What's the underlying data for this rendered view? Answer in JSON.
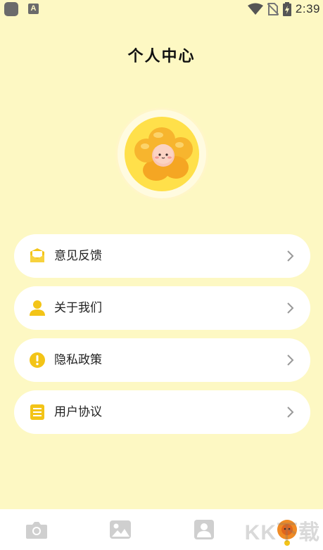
{
  "status_bar": {
    "time": "2:39",
    "icons": [
      "app-icon",
      "a-icon",
      "wifi-icon",
      "no-sim-icon",
      "battery-charging-icon"
    ]
  },
  "header": {
    "title": "个人中心"
  },
  "avatar": {
    "icon": "flower-avatar"
  },
  "menu": {
    "items": [
      {
        "label": "意见反馈",
        "icon": "feedback-envelope-icon"
      },
      {
        "label": "关于我们",
        "icon": "person-icon"
      },
      {
        "label": "隐私政策",
        "icon": "alert-circle-icon"
      },
      {
        "label": "用户协议",
        "icon": "document-icon"
      }
    ]
  },
  "bottom_nav": {
    "tabs": [
      "camera-icon",
      "image-icon",
      "portrait-icon",
      "profile-icon"
    ],
    "active_index": 3
  },
  "watermark": "KK下载",
  "colors": {
    "background": "#fdf8c3",
    "accent": "#f3c417",
    "card": "#ffffff"
  }
}
